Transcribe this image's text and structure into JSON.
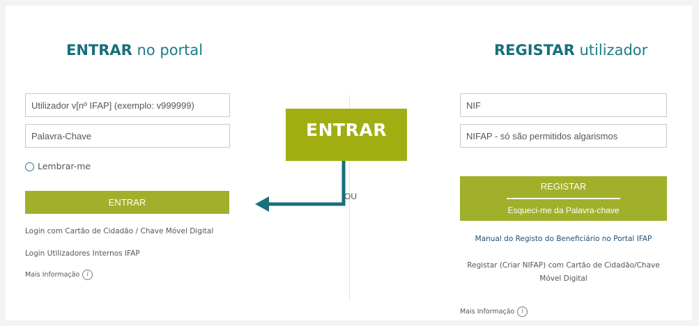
{
  "login": {
    "title_bold": "ENTRAR",
    "title_rest": "no portal",
    "user_placeholder": "Utilizador v[nº IFAP] (exemplo: v999999)",
    "password_placeholder": "Palavra-Chave",
    "remember_label": "Lembrar-me",
    "submit_label": "ENTRAR",
    "link_cc": "Login com Cartão de Cidadão / Chave Móvel Digital",
    "link_internal": "Login Utilizadores Internos IFAP",
    "more_info": "Mais Informação"
  },
  "separator": {
    "label": "OU"
  },
  "register": {
    "title_bold": "REGISTAR",
    "title_rest": "utilizador",
    "nif_placeholder": "NIF",
    "nifap_placeholder": "NIFAP - só são permitidos algarismos",
    "submit_label": "REGISTAR",
    "forgot_label": "Esqueci-me da Palavra-chave",
    "manual_link": "Manual do Registo do Beneficiário no Portal IFAP",
    "register_cc_link": "Registar (Criar NIFAP) com Cartão de Cidadão/Chave Móvel Digital",
    "more_info": "Mais Informação"
  },
  "callout": {
    "label": "ENTRAR"
  },
  "colors": {
    "accent": "#a1b02a",
    "teal": "#1f7a86",
    "arrow": "#18707c"
  },
  "icons": {
    "info": "info-circle-icon",
    "arrow": "arrow-left-icon"
  }
}
